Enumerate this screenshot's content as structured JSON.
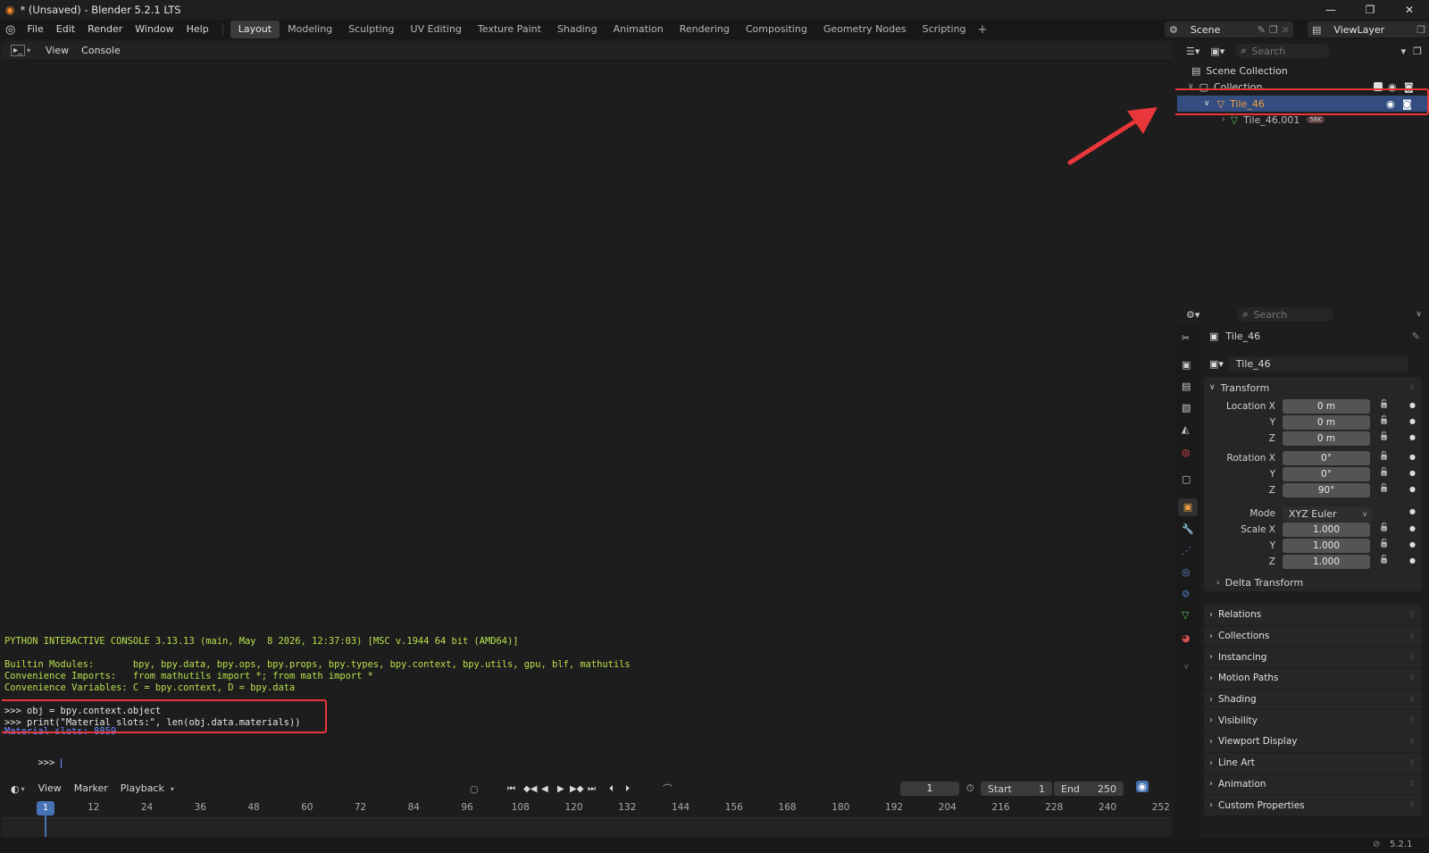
{
  "window": {
    "title": "* (Unsaved) - Blender 5.2.1 LTS"
  },
  "menu": [
    "File",
    "Edit",
    "Render",
    "Window",
    "Help"
  ],
  "workspaces": [
    "Layout",
    "Modeling",
    "Sculpting",
    "UV Editing",
    "Texture Paint",
    "Shading",
    "Animation",
    "Rendering",
    "Compositing",
    "Geometry Nodes",
    "Scripting"
  ],
  "active_workspace": "Layout",
  "scene": {
    "name": "Scene",
    "view_layer": "ViewLayer"
  },
  "console": {
    "header": {
      "view": "View",
      "console": "Console"
    },
    "banner": "PYTHON INTERACTIVE CONSOLE 3.13.13 (main, May  8 2026, 12:37:03) [MSC v.1944 64 bit (AMD64)]",
    "builtin": "Builtin Modules:       bpy, bpy.data, bpy.ops, bpy.props, bpy.types, bpy.context, bpy.utils, gpu, blf, mathutils",
    "imports": "Convenience Imports:   from mathutils import *; from math import *",
    "variables": "Convenience Variables: C = bpy.context, D = bpy.data",
    "cmd1": ">>> obj = bpy.context.object",
    "cmd2": ">>> print(\"Material slots:\", len(obj.data.materials))",
    "output": "Material slots: 8859",
    "prompt": ">>> "
  },
  "timeline": {
    "view": "View",
    "marker": "Marker",
    "playback": "Playback",
    "current_frame": "1",
    "start_label": "Start",
    "start": "1",
    "end_label": "End",
    "end": "250",
    "ruler": [
      "1",
      "12",
      "24",
      "36",
      "48",
      "60",
      "72",
      "84",
      "96",
      "108",
      "120",
      "132",
      "144",
      "156",
      "168",
      "180",
      "192",
      "204",
      "216",
      "228",
      "240",
      "252"
    ]
  },
  "outliner": {
    "search_placeholder": "Search",
    "scene_collection": "Scene Collection",
    "collection": "Collection",
    "object": "Tile_46",
    "child": "Tile_46.001",
    "child_badge": "58K"
  },
  "properties": {
    "search_placeholder": "Search",
    "object_name": "Tile_46",
    "datablock": "Tile_46",
    "transform": "Transform",
    "location_label": "Location X",
    "y_label": "Y",
    "z_label": "Z",
    "location": [
      "0 m",
      "0 m",
      "0 m"
    ],
    "rotation_label": "Rotation X",
    "rotation": [
      "0°",
      "0°",
      "90°"
    ],
    "mode_label": "Mode",
    "mode": "XYZ Euler",
    "scale_label": "Scale X",
    "scale": [
      "1.000",
      "1.000",
      "1.000"
    ],
    "delta": "Delta Transform",
    "panels": [
      "Relations",
      "Collections",
      "Instancing",
      "Motion Paths",
      "Shading",
      "Visibility",
      "Viewport Display",
      "Line Art",
      "Animation",
      "Custom Properties"
    ]
  },
  "status": {
    "version": "5.2.1"
  },
  "colors": {
    "accent": "#4772b3",
    "highlight_box": "#e8363a",
    "console_green": "#b7e04c"
  }
}
